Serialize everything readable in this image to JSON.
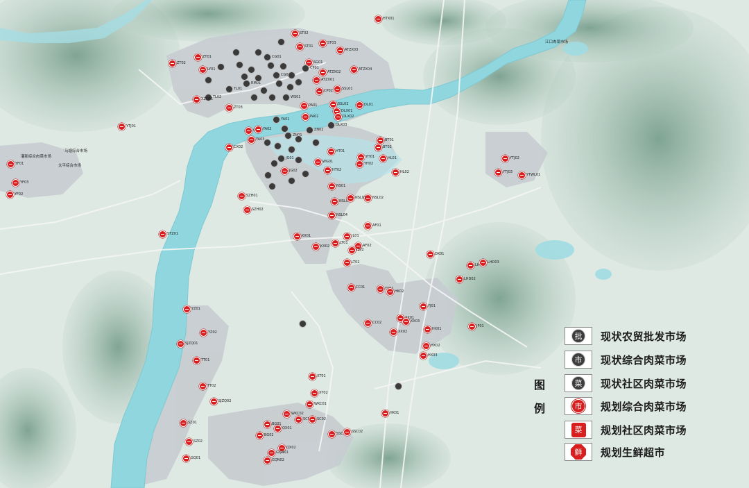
{
  "colors": {
    "background": "#dfe9e4",
    "river": "#8fd6de",
    "mountain": "#7fa594",
    "urban": "#c9cdd0",
    "planned_market": "#d81e1e",
    "existing_market": "#3a3a3a"
  },
  "legend": {
    "title_line1": "图",
    "title_line2": "例",
    "items": [
      {
        "symbol_char": "批",
        "symbol_style": "dark-circle",
        "label": "现状农贸批发市场"
      },
      {
        "symbol_char": "市",
        "symbol_style": "dark-circle",
        "label": "现状综合肉菜市场"
      },
      {
        "symbol_char": "菜",
        "symbol_style": "dark-circle",
        "label": "现状社区肉菜市场"
      },
      {
        "symbol_char": "市",
        "symbol_style": "red-circle",
        "label": "规划综合肉菜市场"
      },
      {
        "symbol_char": "菜",
        "symbol_style": "red-square",
        "label": "规划社区肉菜市场"
      },
      {
        "symbol_char": "鲜",
        "symbol_style": "red-octagon",
        "label": "规划生鲜超市"
      }
    ]
  },
  "map_labels": [
    "江口肉菜市场",
    "太平综合市场",
    "灌新综合肉菜市场",
    "马塘综合市场"
  ],
  "market_codes": [
    "HTX01",
    "ZT01",
    "ZT02",
    "LY01",
    "CG01",
    "CG02",
    "ST01",
    "ST02",
    "ST03",
    "SG01",
    "ATZX03",
    "ATZX02",
    "ATZX01",
    "ATZX04",
    "CP01",
    "CP02",
    "WS01",
    "TL01",
    "TL02",
    "XZQ01",
    "RM01",
    "ZT03",
    "SSL01",
    "SSL02",
    "DLX01",
    "DLX02",
    "DLX03",
    "DL01",
    "PA01",
    "PA02",
    "CX01",
    "CX02",
    "YA01",
    "YA02",
    "YA03",
    "JG01",
    "JG02",
    "ZN01",
    "ZN02",
    "BT01",
    "BT02",
    "YH01",
    "YH02",
    "HL01",
    "HL02",
    "HT01",
    "HT02",
    "NS01",
    "NSL01",
    "NSL02",
    "NSL03",
    "NSL04",
    "WG01",
    "KX01",
    "KX02",
    "SZH01",
    "SZH02",
    "STZ01",
    "YF01",
    "YF02",
    "YF03",
    "YTJ01",
    "YTJ02",
    "YTJ03",
    "YTWL01",
    "LHD01",
    "LHD02",
    "LHD03",
    "DK01",
    "AF01",
    "AF02",
    "JL01",
    "JL02",
    "LT01",
    "LT02",
    "CC01",
    "CC02",
    "YY01",
    "XX01",
    "XX02",
    "XX03",
    "YJ01",
    "HX01",
    "HX02",
    "HX03",
    "YZ01",
    "YZ02",
    "SJZQ01",
    "TT01",
    "TT02",
    "SJZQ02",
    "XT01",
    "XT02",
    "WKC01",
    "WKC02",
    "SC01",
    "SC02",
    "SSC01",
    "SSC02",
    "BG01",
    "BG02",
    "QX01",
    "QX02",
    "SZ01",
    "SZ02",
    "GQ01",
    "GQN01",
    "GQN02",
    "HK01",
    "HK02",
    "JF01",
    "SY01",
    "SY02"
  ]
}
